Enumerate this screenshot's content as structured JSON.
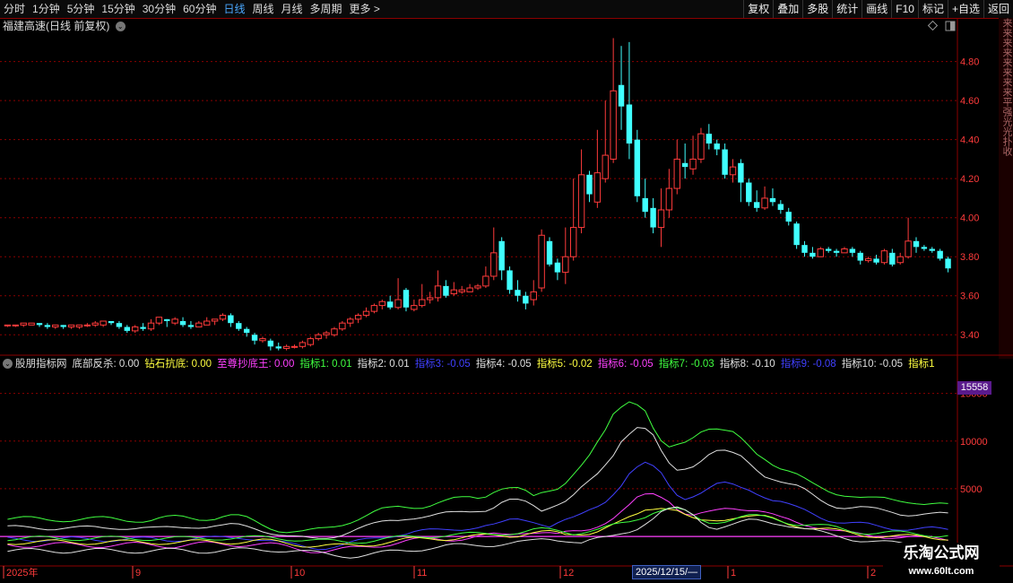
{
  "toolbar": {
    "periods": [
      "分时",
      "1分钟",
      "5分钟",
      "15分钟",
      "30分钟",
      "60分钟",
      "日线",
      "周线",
      "月线",
      "多周期",
      "更多 >"
    ],
    "active_period": "日线",
    "actions": [
      "复权",
      "叠加",
      "多股",
      "统计",
      "画线",
      "F10",
      "标记",
      "+自选",
      "返回"
    ]
  },
  "main_chart": {
    "title": "福建高速(日线 前复权)",
    "y_ticks": [
      "4.80",
      "4.60",
      "4.40",
      "4.20",
      "4.00",
      "3.80",
      "3.60",
      "3.40"
    ],
    "side_text": "来来来来来来来来平强光光扑收"
  },
  "indicator": {
    "name": "股朋指标网",
    "items": [
      {
        "label": "底部反杀: 0.00",
        "color": "#e0e0e0"
      },
      {
        "label": "钻石抗底: 0.00",
        "color": "#ffff40"
      },
      {
        "label": "至尊抄底王: 0.00",
        "color": "#ff40ff"
      },
      {
        "label": "指标1: 0.01",
        "color": "#40ff40"
      },
      {
        "label": "指标2: 0.01",
        "color": "#e0e0e0"
      },
      {
        "label": "指标3: -0.05",
        "color": "#4040ff"
      },
      {
        "label": "指标4: -0.05",
        "color": "#e0e0e0"
      },
      {
        "label": "指标5: -0.02",
        "color": "#ffff40"
      },
      {
        "label": "指标6: -0.05",
        "color": "#ff40ff"
      },
      {
        "label": "指标7: -0.03",
        "color": "#40ff40"
      },
      {
        "label": "指标8: -0.10",
        "color": "#e0e0e0"
      },
      {
        "label": "指标9: -0.08",
        "color": "#4040ff"
      },
      {
        "label": "指标10: -0.05",
        "color": "#e0e0e0"
      },
      {
        "label": "指标1",
        "color": "#ffff40"
      }
    ],
    "current_value": "15558",
    "y_ticks": [
      "15000",
      "10000",
      "5000"
    ]
  },
  "x_axis": {
    "labels": [
      "2025年",
      "9",
      "10",
      "11",
      "12",
      "1",
      "2"
    ],
    "cursor_date": "2025/12/15/—"
  },
  "watermark": {
    "line1": "乐淘公式网",
    "line2": "www.60lt.com"
  },
  "colors": {
    "up": "#ff3b3b",
    "down": "#40ffff",
    "grid": "#8b0000"
  },
  "chart_data": {
    "type": "candlestick",
    "candles": [
      [
        3.45,
        3.45,
        3.45,
        3.44
      ],
      [
        3.45,
        3.45,
        3.45,
        3.44
      ],
      [
        3.45,
        3.46,
        3.46,
        3.44
      ],
      [
        3.45,
        3.46,
        3.46,
        3.45
      ],
      [
        3.46,
        3.45,
        3.46,
        3.44
      ],
      [
        3.45,
        3.44,
        3.46,
        3.43
      ],
      [
        3.44,
        3.45,
        3.45,
        3.43
      ],
      [
        3.45,
        3.44,
        3.45,
        3.43
      ],
      [
        3.44,
        3.45,
        3.45,
        3.43
      ],
      [
        3.44,
        3.45,
        3.45,
        3.43
      ],
      [
        3.45,
        3.45,
        3.46,
        3.44
      ],
      [
        3.45,
        3.46,
        3.47,
        3.44
      ],
      [
        3.45,
        3.47,
        3.47,
        3.44
      ],
      [
        3.47,
        3.46,
        3.47,
        3.45
      ],
      [
        3.46,
        3.44,
        3.47,
        3.43
      ],
      [
        3.44,
        3.42,
        3.45,
        3.41
      ],
      [
        3.42,
        3.44,
        3.45,
        3.41
      ],
      [
        3.44,
        3.43,
        3.46,
        3.42
      ],
      [
        3.43,
        3.46,
        3.48,
        3.42
      ],
      [
        3.46,
        3.49,
        3.49,
        3.45
      ],
      [
        3.48,
        3.47,
        3.48,
        3.44
      ],
      [
        3.46,
        3.48,
        3.49,
        3.45
      ],
      [
        3.47,
        3.45,
        3.49,
        3.44
      ],
      [
        3.45,
        3.44,
        3.47,
        3.43
      ],
      [
        3.44,
        3.46,
        3.47,
        3.44
      ],
      [
        3.45,
        3.47,
        3.49,
        3.45
      ],
      [
        3.47,
        3.48,
        3.48,
        3.45
      ],
      [
        3.48,
        3.5,
        3.51,
        3.47
      ],
      [
        3.5,
        3.46,
        3.51,
        3.44
      ],
      [
        3.46,
        3.43,
        3.47,
        3.42
      ],
      [
        3.43,
        3.41,
        3.44,
        3.39
      ],
      [
        3.4,
        3.37,
        3.41,
        3.35
      ],
      [
        3.37,
        3.38,
        3.39,
        3.36
      ],
      [
        3.37,
        3.34,
        3.38,
        3.32
      ],
      [
        3.34,
        3.33,
        3.36,
        3.32
      ],
      [
        3.33,
        3.34,
        3.35,
        3.32
      ],
      [
        3.34,
        3.34,
        3.35,
        3.33
      ],
      [
        3.34,
        3.36,
        3.37,
        3.33
      ],
      [
        3.35,
        3.38,
        3.39,
        3.34
      ],
      [
        3.38,
        3.4,
        3.41,
        3.37
      ],
      [
        3.4,
        3.41,
        3.42,
        3.38
      ],
      [
        3.4,
        3.43,
        3.44,
        3.39
      ],
      [
        3.43,
        3.46,
        3.47,
        3.42
      ],
      [
        3.46,
        3.48,
        3.49,
        3.44
      ],
      [
        3.48,
        3.5,
        3.51,
        3.46
      ],
      [
        3.5,
        3.52,
        3.54,
        3.49
      ],
      [
        3.52,
        3.55,
        3.56,
        3.51
      ],
      [
        3.55,
        3.57,
        3.58,
        3.53
      ],
      [
        3.57,
        3.54,
        3.6,
        3.53
      ],
      [
        3.54,
        3.58,
        3.69,
        3.53
      ],
      [
        3.63,
        3.54,
        3.64,
        3.52
      ],
      [
        3.53,
        3.55,
        3.58,
        3.52
      ],
      [
        3.55,
        3.58,
        3.66,
        3.54
      ],
      [
        3.58,
        3.59,
        3.62,
        3.56
      ],
      [
        3.59,
        3.65,
        3.73,
        3.57
      ],
      [
        3.65,
        3.6,
        3.68,
        3.59
      ],
      [
        3.61,
        3.63,
        3.67,
        3.6
      ],
      [
        3.62,
        3.63,
        3.65,
        3.61
      ],
      [
        3.62,
        3.64,
        3.66,
        3.62
      ],
      [
        3.64,
        3.65,
        3.66,
        3.63
      ],
      [
        3.65,
        3.7,
        3.75,
        3.64
      ],
      [
        3.7,
        3.82,
        3.95,
        3.68
      ],
      [
        3.88,
        3.73,
        3.9,
        3.68
      ],
      [
        3.73,
        3.63,
        3.75,
        3.61
      ],
      [
        3.63,
        3.6,
        3.68,
        3.57
      ],
      [
        3.6,
        3.56,
        3.62,
        3.53
      ],
      [
        3.58,
        3.62,
        3.68,
        3.55
      ],
      [
        3.64,
        3.91,
        3.94,
        3.62
      ],
      [
        3.88,
        3.76,
        3.9,
        3.75
      ],
      [
        3.77,
        3.72,
        3.79,
        3.68
      ],
      [
        3.72,
        3.8,
        3.95,
        3.66
      ],
      [
        3.8,
        3.95,
        4.2,
        3.78
      ],
      [
        3.95,
        4.22,
        4.35,
        3.92
      ],
      [
        4.22,
        4.12,
        4.24,
        4.08
      ],
      [
        4.08,
        4.23,
        4.45,
        4.05
      ],
      [
        4.2,
        4.32,
        4.6,
        4.18
      ],
      [
        4.3,
        4.65,
        4.92,
        4.28
      ],
      [
        4.68,
        4.57,
        4.88,
        4.45
      ],
      [
        4.58,
        4.38,
        4.9,
        4.3
      ],
      [
        4.4,
        4.11,
        4.45,
        4.08
      ],
      [
        4.1,
        4.03,
        4.2,
        4.0
      ],
      [
        4.05,
        3.95,
        4.1,
        3.92
      ],
      [
        3.95,
        4.04,
        4.15,
        3.85
      ],
      [
        4.04,
        4.15,
        4.25,
        4.0
      ],
      [
        4.15,
        4.3,
        4.4,
        4.12
      ],
      [
        4.28,
        4.26,
        4.38,
        4.2
      ],
      [
        4.25,
        4.3,
        4.42,
        4.22
      ],
      [
        4.3,
        4.43,
        4.46,
        4.28
      ],
      [
        4.43,
        4.38,
        4.48,
        4.35
      ],
      [
        4.38,
        4.35,
        4.4,
        4.32
      ],
      [
        4.35,
        4.22,
        4.38,
        4.2
      ],
      [
        4.22,
        4.26,
        4.3,
        4.18
      ],
      [
        4.28,
        4.18,
        4.3,
        4.08
      ],
      [
        4.18,
        4.08,
        4.2,
        4.06
      ],
      [
        4.08,
        4.05,
        4.14,
        4.03
      ],
      [
        4.05,
        4.1,
        4.16,
        4.04
      ],
      [
        4.1,
        4.08,
        4.15,
        4.06
      ],
      [
        4.07,
        4.04,
        4.09,
        4.02
      ],
      [
        4.03,
        3.98,
        4.05,
        3.96
      ],
      [
        3.97,
        3.86,
        3.98,
        3.84
      ],
      [
        3.86,
        3.82,
        3.88,
        3.8
      ],
      [
        3.82,
        3.8,
        3.85,
        3.79
      ],
      [
        3.8,
        3.84,
        3.85,
        3.8
      ],
      [
        3.84,
        3.83,
        3.85,
        3.82
      ],
      [
        3.83,
        3.82,
        3.84,
        3.8
      ],
      [
        3.82,
        3.84,
        3.85,
        3.82
      ],
      [
        3.84,
        3.82,
        3.85,
        3.8
      ],
      [
        3.82,
        3.78,
        3.83,
        3.76
      ],
      [
        3.78,
        3.79,
        3.8,
        3.77
      ],
      [
        3.79,
        3.77,
        3.81,
        3.76
      ],
      [
        3.77,
        3.83,
        3.84,
        3.76
      ],
      [
        3.82,
        3.76,
        3.84,
        3.75
      ],
      [
        3.77,
        3.8,
        3.82,
        3.76
      ],
      [
        3.8,
        3.88,
        4.0,
        3.79
      ],
      [
        3.88,
        3.85,
        3.9,
        3.82
      ],
      [
        3.85,
        3.84,
        3.86,
        3.83
      ],
      [
        3.84,
        3.83,
        3.85,
        3.82
      ],
      [
        3.83,
        3.79,
        3.84,
        3.78
      ],
      [
        3.79,
        3.74,
        3.8,
        3.72
      ]
    ]
  }
}
